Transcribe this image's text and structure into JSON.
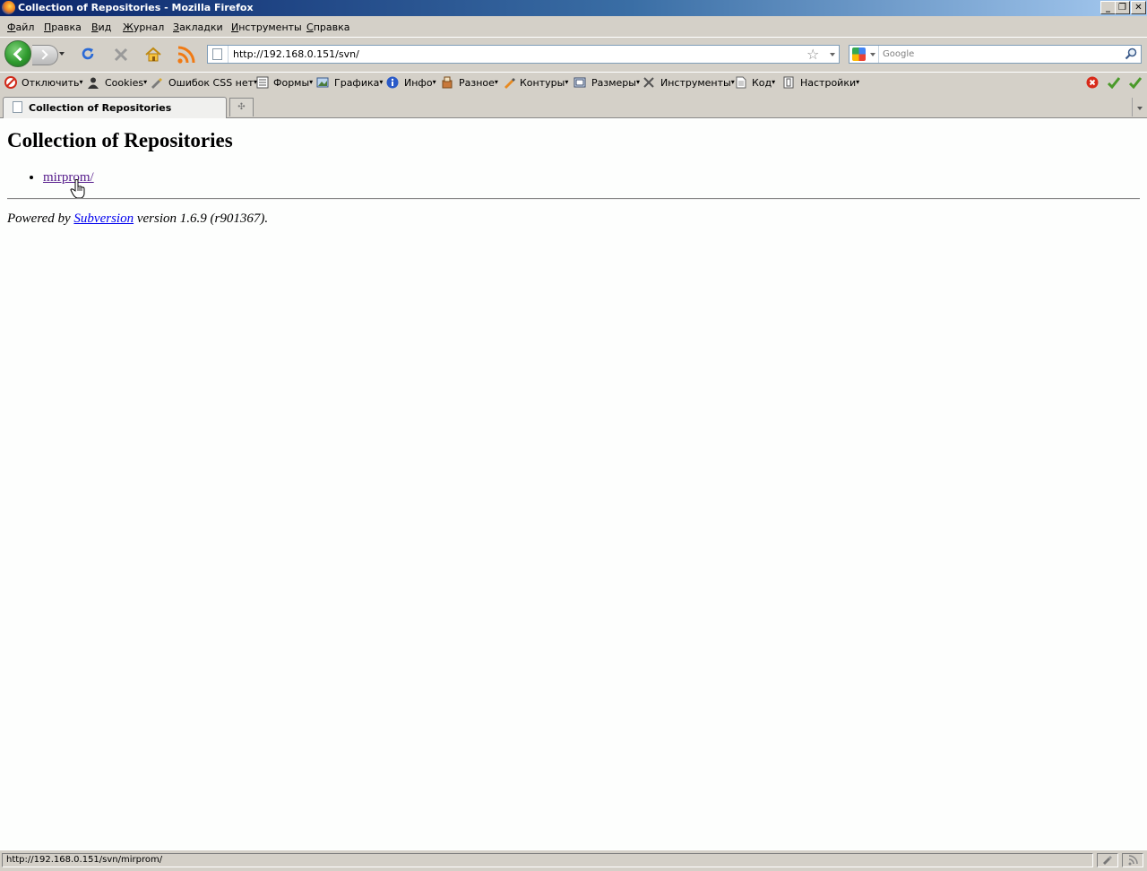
{
  "window": {
    "title": "Collection of Repositories - Mozilla Firefox",
    "controls": {
      "minimize": "_",
      "restore": "❐",
      "close": "✕"
    }
  },
  "menubar": {
    "items": [
      "Файл",
      "Правка",
      "Вид",
      "Журнал",
      "Закладки",
      "Инструменты",
      "Справка"
    ]
  },
  "navbar": {
    "url": "http://192.168.0.151/svn/",
    "search_placeholder": "Google",
    "icons": [
      "back-icon",
      "forward-icon",
      "reload-icon",
      "stop-icon",
      "home-icon",
      "rss-icon",
      "bookmark-star-icon",
      "google-icon",
      "search-icon"
    ]
  },
  "devbar": {
    "items": [
      "Отключить",
      "Cookies",
      "Ошибок CSS нет",
      "Формы",
      "Графика",
      "Инфо",
      "Разное",
      "Контуры",
      "Размеры",
      "Инструменты",
      "Код",
      "Настройки"
    ],
    "arrow": "▾"
  },
  "tabs": {
    "active": "Collection of Repositories",
    "new_tab_glyph": "✣"
  },
  "content": {
    "heading": "Collection of Repositories",
    "repositories": [
      "mirprom/"
    ],
    "footer": {
      "prefix": "Powered by ",
      "link": "Subversion",
      "suffix": " version 1.6.9 (r901367)."
    }
  },
  "statusbar": {
    "text": "http://192.168.0.151/svn/mirprom/"
  },
  "colors": {
    "chrome": "#d4d0c8",
    "titlebar_start": "#0a246a",
    "titlebar_end": "#a6caf0",
    "link": "#0000ee",
    "visited": "#551a8b"
  }
}
